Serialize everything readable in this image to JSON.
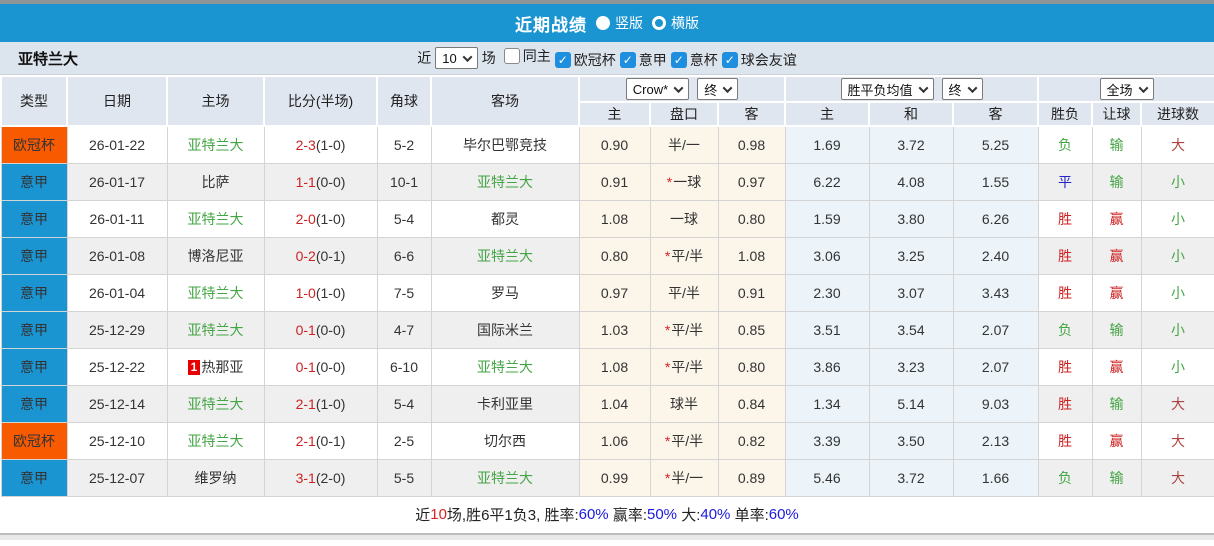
{
  "palette": {
    "bar_blue": "#1b94d2",
    "league_orange": "#f85a00",
    "checkbox_blue": "#1e8fdf",
    "win_red": "#cf2222",
    "lose_green": "#44a544",
    "draw_blue": "#2323c8",
    "big_dark_red": "#a94442",
    "cream_bg": "#fbf5ea",
    "avg_bg": "#ecf4f9"
  },
  "title_bar": {
    "title": "近期战绩",
    "radio_vertical": "竖版",
    "radio_horizontal": "横版"
  },
  "filter_bar": {
    "team": "亚特兰大",
    "near_label": "近",
    "count_value": "10",
    "games_label": "场",
    "checkboxes": [
      {
        "label": "同主",
        "checked": false
      },
      {
        "label": "欧冠杯",
        "checked": true
      },
      {
        "label": "意甲",
        "checked": true
      },
      {
        "label": "意杯",
        "checked": true
      },
      {
        "label": "球会友谊",
        "checked": true
      }
    ]
  },
  "table": {
    "selects": {
      "odds_company": "Crow*",
      "odds_time": "终",
      "avg_type": "胜平负均值",
      "avg_time": "终",
      "scope": "全场"
    },
    "columns": [
      "类型",
      "日期",
      "主场",
      "比分(半场)",
      "角球",
      "客场",
      "主",
      "盘口",
      "客",
      "主",
      "和",
      "客",
      "胜负",
      "让球",
      "进球数"
    ],
    "rows": [
      {
        "type": "欧冠杯",
        "type_bg": "orange",
        "date": "26-01-22",
        "home": "亚特兰大",
        "home_color": "green",
        "home_badge": "",
        "score": "2-3",
        "half": "(1-0)",
        "corner": "5-2",
        "away": "毕尔巴鄂竞技",
        "away_color": "black",
        "odds": [
          "0.90",
          "半/一",
          "0.98"
        ],
        "pan_star": "",
        "avg": [
          "1.69",
          "3.72",
          "5.25"
        ],
        "result": {
          "text": "负",
          "color": "green"
        },
        "handicap_result": {
          "text": "输",
          "color": "green"
        },
        "goals": {
          "text": "大",
          "color": "dred"
        }
      },
      {
        "type": "意甲",
        "type_bg": "blue",
        "date": "26-01-17",
        "home": "比萨",
        "home_color": "black",
        "home_badge": "",
        "score": "1-1",
        "half": "(0-0)",
        "corner": "10-1",
        "away": "亚特兰大",
        "away_color": "green",
        "odds": [
          "0.91",
          "一球",
          "0.97"
        ],
        "pan_star": "*",
        "avg": [
          "6.22",
          "4.08",
          "1.55"
        ],
        "result": {
          "text": "平",
          "color": "blue"
        },
        "handicap_result": {
          "text": "输",
          "color": "green"
        },
        "goals": {
          "text": "小",
          "color": "green"
        }
      },
      {
        "type": "意甲",
        "type_bg": "blue",
        "date": "26-01-11",
        "home": "亚特兰大",
        "home_color": "green",
        "home_badge": "",
        "score": "2-0",
        "half": "(1-0)",
        "corner": "5-4",
        "away": "都灵",
        "away_color": "black",
        "odds": [
          "1.08",
          "一球",
          "0.80"
        ],
        "pan_star": "",
        "avg": [
          "1.59",
          "3.80",
          "6.26"
        ],
        "result": {
          "text": "胜",
          "color": "red"
        },
        "handicap_result": {
          "text": "赢",
          "color": "red"
        },
        "goals": {
          "text": "小",
          "color": "green"
        }
      },
      {
        "type": "意甲",
        "type_bg": "blue",
        "date": "26-01-08",
        "home": "博洛尼亚",
        "home_color": "black",
        "home_badge": "",
        "score": "0-2",
        "half": "(0-1)",
        "corner": "6-6",
        "away": "亚特兰大",
        "away_color": "green",
        "odds": [
          "0.80",
          "平/半",
          "1.08"
        ],
        "pan_star": "*",
        "avg": [
          "3.06",
          "3.25",
          "2.40"
        ],
        "result": {
          "text": "胜",
          "color": "red"
        },
        "handicap_result": {
          "text": "赢",
          "color": "red"
        },
        "goals": {
          "text": "小",
          "color": "green"
        }
      },
      {
        "type": "意甲",
        "type_bg": "blue",
        "date": "26-01-04",
        "home": "亚特兰大",
        "home_color": "green",
        "home_badge": "",
        "score": "1-0",
        "half": "(1-0)",
        "corner": "7-5",
        "away": "罗马",
        "away_color": "black",
        "odds": [
          "0.97",
          "平/半",
          "0.91"
        ],
        "pan_star": "",
        "avg": [
          "2.30",
          "3.07",
          "3.43"
        ],
        "result": {
          "text": "胜",
          "color": "red"
        },
        "handicap_result": {
          "text": "赢",
          "color": "red"
        },
        "goals": {
          "text": "小",
          "color": "green"
        }
      },
      {
        "type": "意甲",
        "type_bg": "blue",
        "date": "25-12-29",
        "home": "亚特兰大",
        "home_color": "green",
        "home_badge": "",
        "score": "0-1",
        "half": "(0-0)",
        "corner": "4-7",
        "away": "国际米兰",
        "away_color": "black",
        "odds": [
          "1.03",
          "平/半",
          "0.85"
        ],
        "pan_star": "*",
        "avg": [
          "3.51",
          "3.54",
          "2.07"
        ],
        "result": {
          "text": "负",
          "color": "green"
        },
        "handicap_result": {
          "text": "输",
          "color": "green"
        },
        "goals": {
          "text": "小",
          "color": "green"
        }
      },
      {
        "type": "意甲",
        "type_bg": "blue",
        "date": "25-12-22",
        "home": "热那亚",
        "home_color": "black",
        "home_badge": "1",
        "score": "0-1",
        "half": "(0-0)",
        "corner": "6-10",
        "away": "亚特兰大",
        "away_color": "green",
        "odds": [
          "1.08",
          "平/半",
          "0.80"
        ],
        "pan_star": "*",
        "avg": [
          "3.86",
          "3.23",
          "2.07"
        ],
        "result": {
          "text": "胜",
          "color": "red"
        },
        "handicap_result": {
          "text": "赢",
          "color": "red"
        },
        "goals": {
          "text": "小",
          "color": "green"
        }
      },
      {
        "type": "意甲",
        "type_bg": "blue",
        "date": "25-12-14",
        "home": "亚特兰大",
        "home_color": "green",
        "home_badge": "",
        "score": "2-1",
        "half": "(1-0)",
        "corner": "5-4",
        "away": "卡利亚里",
        "away_color": "black",
        "odds": [
          "1.04",
          "球半",
          "0.84"
        ],
        "pan_star": "",
        "avg": [
          "1.34",
          "5.14",
          "9.03"
        ],
        "result": {
          "text": "胜",
          "color": "red"
        },
        "handicap_result": {
          "text": "输",
          "color": "green"
        },
        "goals": {
          "text": "大",
          "color": "dred"
        }
      },
      {
        "type": "欧冠杯",
        "type_bg": "orange",
        "date": "25-12-10",
        "home": "亚特兰大",
        "home_color": "green",
        "home_badge": "",
        "score": "2-1",
        "half": "(0-1)",
        "corner": "2-5",
        "away": "切尔西",
        "away_color": "black",
        "odds": [
          "1.06",
          "平/半",
          "0.82"
        ],
        "pan_star": "*",
        "avg": [
          "3.39",
          "3.50",
          "2.13"
        ],
        "result": {
          "text": "胜",
          "color": "red"
        },
        "handicap_result": {
          "text": "赢",
          "color": "red"
        },
        "goals": {
          "text": "大",
          "color": "dred"
        }
      },
      {
        "type": "意甲",
        "type_bg": "blue",
        "date": "25-12-07",
        "home": "维罗纳",
        "home_color": "black",
        "home_badge": "",
        "score": "3-1",
        "half": "(2-0)",
        "corner": "5-5",
        "away": "亚特兰大",
        "away_color": "green",
        "odds": [
          "0.99",
          "半/一",
          "0.89"
        ],
        "pan_star": "*",
        "avg": [
          "5.46",
          "3.72",
          "1.66"
        ],
        "result": {
          "text": "负",
          "color": "green"
        },
        "handicap_result": {
          "text": "输",
          "color": "green"
        },
        "goals": {
          "text": "大",
          "color": "dred"
        }
      }
    ]
  },
  "summary": {
    "segments": [
      {
        "text": "近",
        "color": "black"
      },
      {
        "text": "10",
        "color": "red"
      },
      {
        "text": "场,胜6平1负3, 胜率:",
        "color": "black"
      },
      {
        "text": "60%",
        "color": "blue"
      },
      {
        "text": " 赢率:",
        "color": "black"
      },
      {
        "text": "50%",
        "color": "blue"
      },
      {
        "text": " 大:",
        "color": "black"
      },
      {
        "text": "40%",
        "color": "blue"
      },
      {
        "text": " 单率:",
        "color": "black"
      },
      {
        "text": "60%",
        "color": "blue"
      }
    ]
  }
}
